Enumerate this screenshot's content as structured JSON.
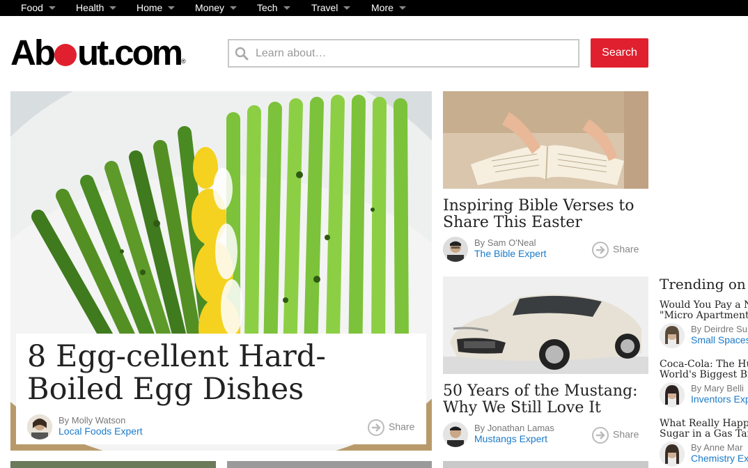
{
  "nav": {
    "items": [
      {
        "label": "Food"
      },
      {
        "label": "Health"
      },
      {
        "label": "Home"
      },
      {
        "label": "Money"
      },
      {
        "label": "Tech"
      },
      {
        "label": "Travel"
      },
      {
        "label": "More"
      }
    ]
  },
  "header": {
    "logo_text_a": "Ab",
    "logo_text_b": "ut.com",
    "logo_tm": "®",
    "search_placeholder": "Learn about…",
    "search_button": "Search"
  },
  "hero": {
    "title": "8 Egg-cellent Hard-Boiled Egg Dishes",
    "author": "By Molly Watson",
    "role": "Local Foods Expert",
    "share": "Share"
  },
  "cards": [
    {
      "title": "Inspiring Bible Verses to Share This Easter",
      "author": "By Sam O'Neal",
      "role": "The Bible Expert",
      "share": "Share"
    },
    {
      "title": "50 Years of the Mustang: Why We Still Love It",
      "author": "By Jonathan Lamas",
      "role": "Mustangs Expert",
      "share": "Share"
    }
  ],
  "trending": {
    "heading": "Trending on",
    "items": [
      {
        "title_line1": "Would You Pay a N",
        "title_line2": "\"Micro Apartment",
        "author": "By Deirdre Su",
        "role": "Small Spaces"
      },
      {
        "title_line1": "Coca-Cola: The Hu",
        "title_line2": "World's Biggest Br",
        "author": "By Mary Belli",
        "role": "Inventors Exp"
      },
      {
        "title_line1": "What Really Happ",
        "title_line2": "Sugar in a Gas Tan",
        "author": "By Anne Mar",
        "role": "Chemistry Ex"
      }
    ]
  },
  "colors": {
    "accent": "#e0202e",
    "link": "#1a7ac9",
    "nav_bg": "#000000"
  }
}
